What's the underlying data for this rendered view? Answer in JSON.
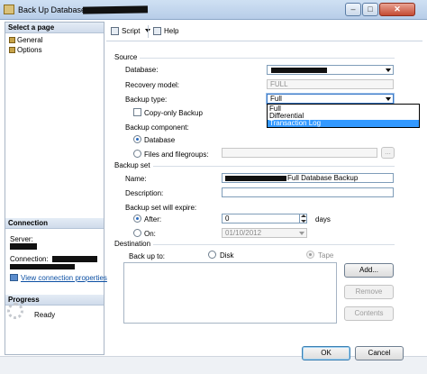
{
  "window": {
    "title": "Back Up Database - "
  },
  "left": {
    "select_page_header": "Select a page",
    "pages": [
      "General",
      "Options"
    ],
    "connection_header": "Connection",
    "server_label": "Server:",
    "connection_label": "Connection:",
    "view_connection_link": "View connection properties",
    "progress_header": "Progress",
    "progress_status": "Ready"
  },
  "toolbar": {
    "script_label": "Script",
    "help_label": "Help"
  },
  "source": {
    "group_label": "Source",
    "database_label": "Database:",
    "recovery_label": "Recovery model:",
    "recovery_value": "FULL",
    "backup_type_label": "Backup type:",
    "backup_type_value": "Full",
    "backup_type_options": [
      "Full",
      "Differential",
      "Transaction Log"
    ],
    "copy_only_label": "Copy-only Backup",
    "component_label": "Backup component:",
    "component_database": "Database",
    "component_files": "Files and filegroups:",
    "browse_label": "..."
  },
  "backup_set": {
    "group_label": "Backup set",
    "name_label": "Name:",
    "name_value": "Full Database Backup",
    "description_label": "Description:",
    "expire_label": "Backup set will expire:",
    "after_label": "After:",
    "after_value": "0",
    "days_label": "days",
    "on_label": "On:",
    "on_value": "01/10/2012"
  },
  "destination": {
    "group_label": "Destination",
    "backup_to_label": "Back up to:",
    "disk_label": "Disk",
    "tape_label": "Tape",
    "add_label": "Add...",
    "remove_label": "Remove",
    "contents_label": "Contents"
  },
  "footer": {
    "ok_label": "OK",
    "cancel_label": "Cancel"
  }
}
